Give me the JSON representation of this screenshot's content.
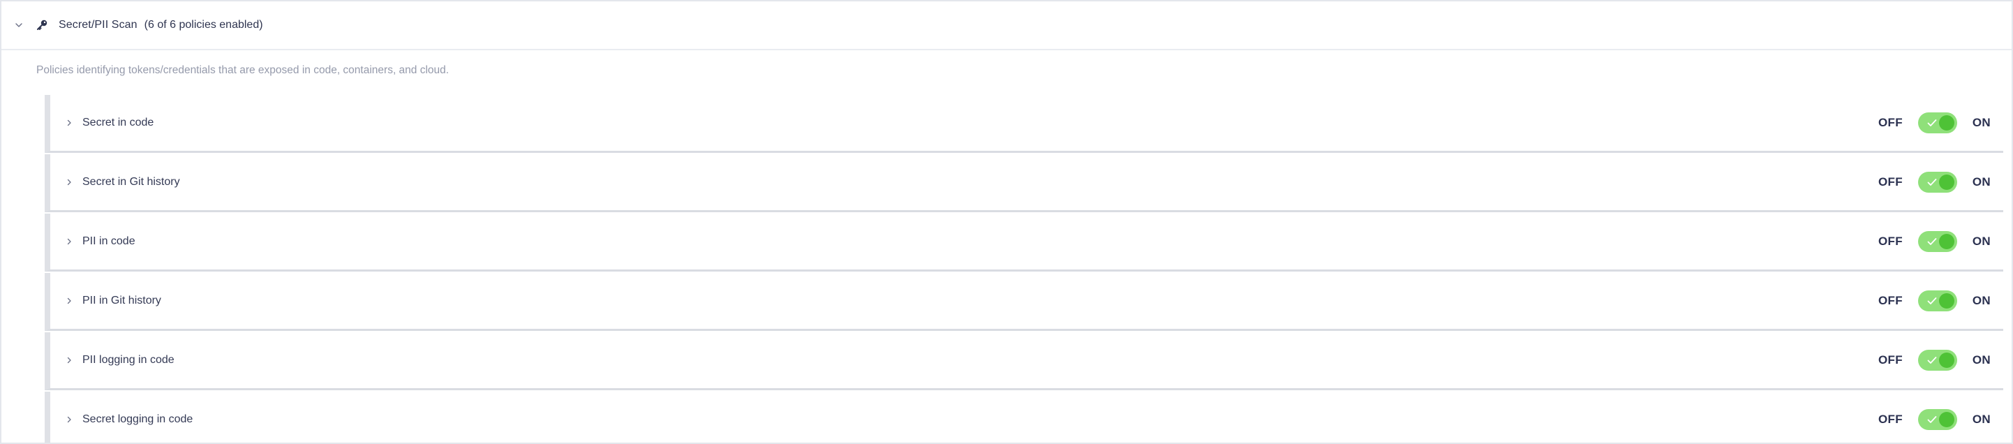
{
  "section": {
    "title": "Secret/PII Scan",
    "count_text": "(6 of 6 policies enabled)",
    "expand_icon": "chevron-down-icon",
    "type_icon": "key-icon",
    "description": "Policies identifying tokens/credentials that are exposed in code, containers, and cloud."
  },
  "toggle_labels": {
    "off": "OFF",
    "on": "ON"
  },
  "colors": {
    "toggle_track": "#8fe07a",
    "toggle_knob": "#4ec236",
    "text_primary": "#2f3550",
    "text_muted": "#959aab"
  },
  "policies": [
    {
      "label": "Secret in code",
      "enabled": true
    },
    {
      "label": "Secret in Git history",
      "enabled": true
    },
    {
      "label": "PII in code",
      "enabled": true
    },
    {
      "label": "PII in Git history",
      "enabled": true
    },
    {
      "label": "PII logging in code",
      "enabled": true
    },
    {
      "label": "Secret logging in code",
      "enabled": true
    }
  ]
}
